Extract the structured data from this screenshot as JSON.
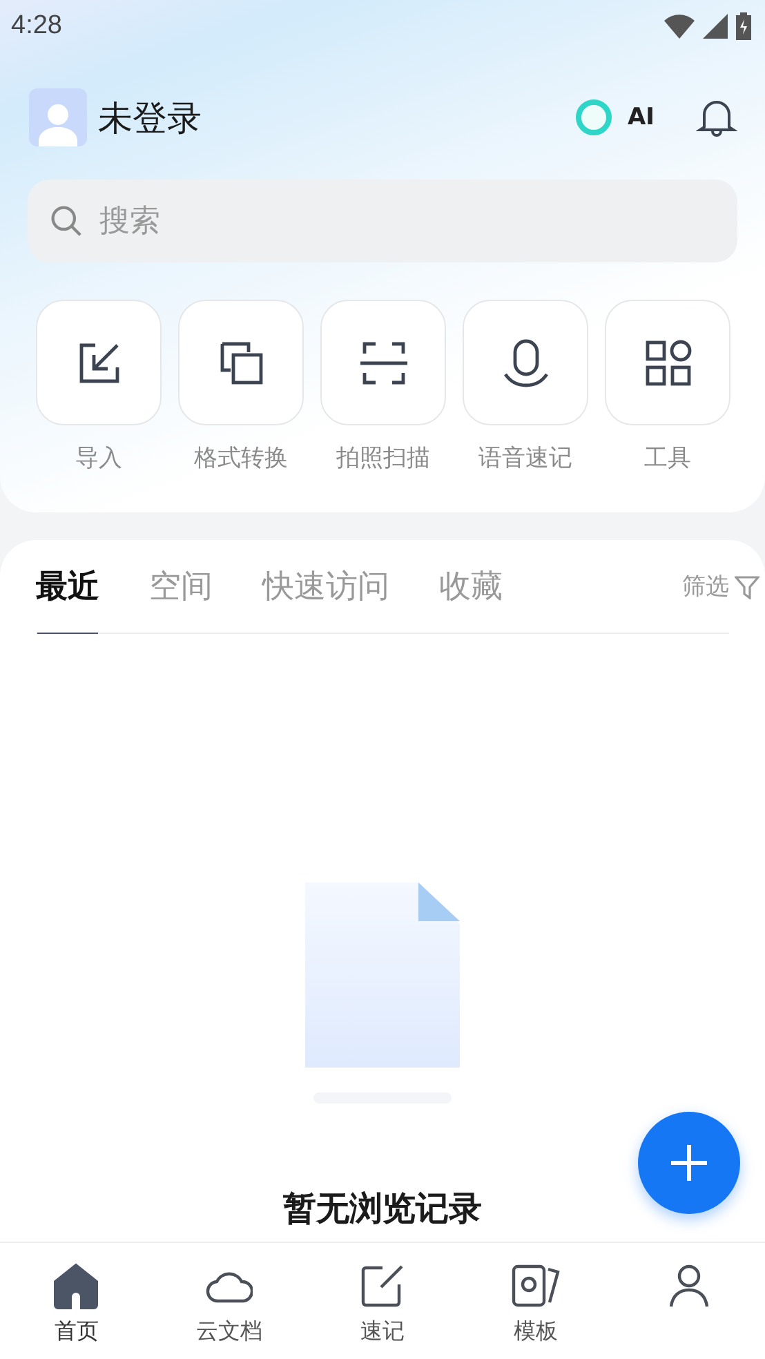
{
  "status_bar": {
    "time": "4:28"
  },
  "header": {
    "user_name": "未登录",
    "ai_label": "AI"
  },
  "search": {
    "placeholder": "搜索"
  },
  "quick_actions": [
    {
      "kind": "import",
      "label": "导入"
    },
    {
      "kind": "convert",
      "label": "格式转换"
    },
    {
      "kind": "scan",
      "label": "拍照扫描"
    },
    {
      "kind": "voice",
      "label": "语音速记"
    },
    {
      "kind": "tools",
      "label": "工具"
    }
  ],
  "tabs": [
    {
      "label": "最近",
      "selected": true
    },
    {
      "label": "空间",
      "selected": false
    },
    {
      "label": "快速访问",
      "selected": false
    },
    {
      "label": "收藏",
      "selected": false
    }
  ],
  "filter": {
    "label": "筛选"
  },
  "empty_state": {
    "message": "暂无浏览记录"
  },
  "bottom_nav": [
    {
      "kind": "home",
      "label": "首页",
      "selected": true
    },
    {
      "kind": "cloud",
      "label": "云文档",
      "selected": false
    },
    {
      "kind": "note",
      "label": "速记",
      "selected": false
    },
    {
      "kind": "template",
      "label": "模板",
      "selected": false
    },
    {
      "kind": "profile",
      "selected": false
    }
  ]
}
